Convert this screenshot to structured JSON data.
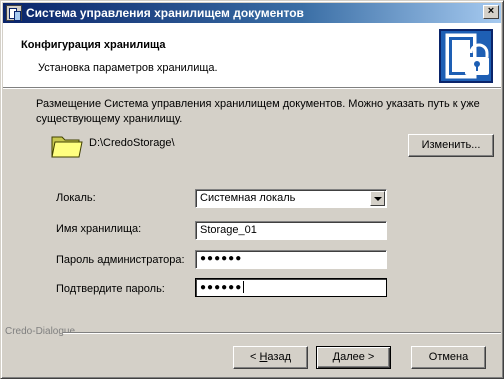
{
  "window": {
    "title": "Система управления хранилищем документов",
    "close_label": "×"
  },
  "header": {
    "title": "Конфигурация хранилища",
    "subtitle": "Установка параметров хранилища.",
    "logo_icon": "document-lock-icon"
  },
  "description": "Размещение Система управления хранилищем документов. Можно указать путь к уже существующему хранилищу.",
  "storage": {
    "path": "D:\\CredoStorage\\",
    "change_button": "Изменить...",
    "icon": "folder-icon"
  },
  "form": {
    "locale_label": "Локаль:",
    "locale_value": "Системная локаль",
    "name_label": "Имя хранилища:",
    "name_value": "Storage_01",
    "admin_password_label": "Пароль администратора:",
    "admin_password_value": "●●●●●●",
    "confirm_password_label": "Подтвердите пароль:",
    "confirm_password_value": "●●●●●●"
  },
  "footer": {
    "brand": "Credo-Dialogue",
    "back_prefix": "< ",
    "back_hotkey": "Н",
    "back_rest": "азад",
    "next_prefix": "",
    "next_hotkey": "Д",
    "next_rest": "алее >",
    "cancel_label": "Отмена"
  },
  "colors": {
    "titlebar_start": "#0a246a",
    "titlebar_end": "#a6caf0",
    "face": "#d4d0c8",
    "logo_blue": "#1e5fb4"
  }
}
